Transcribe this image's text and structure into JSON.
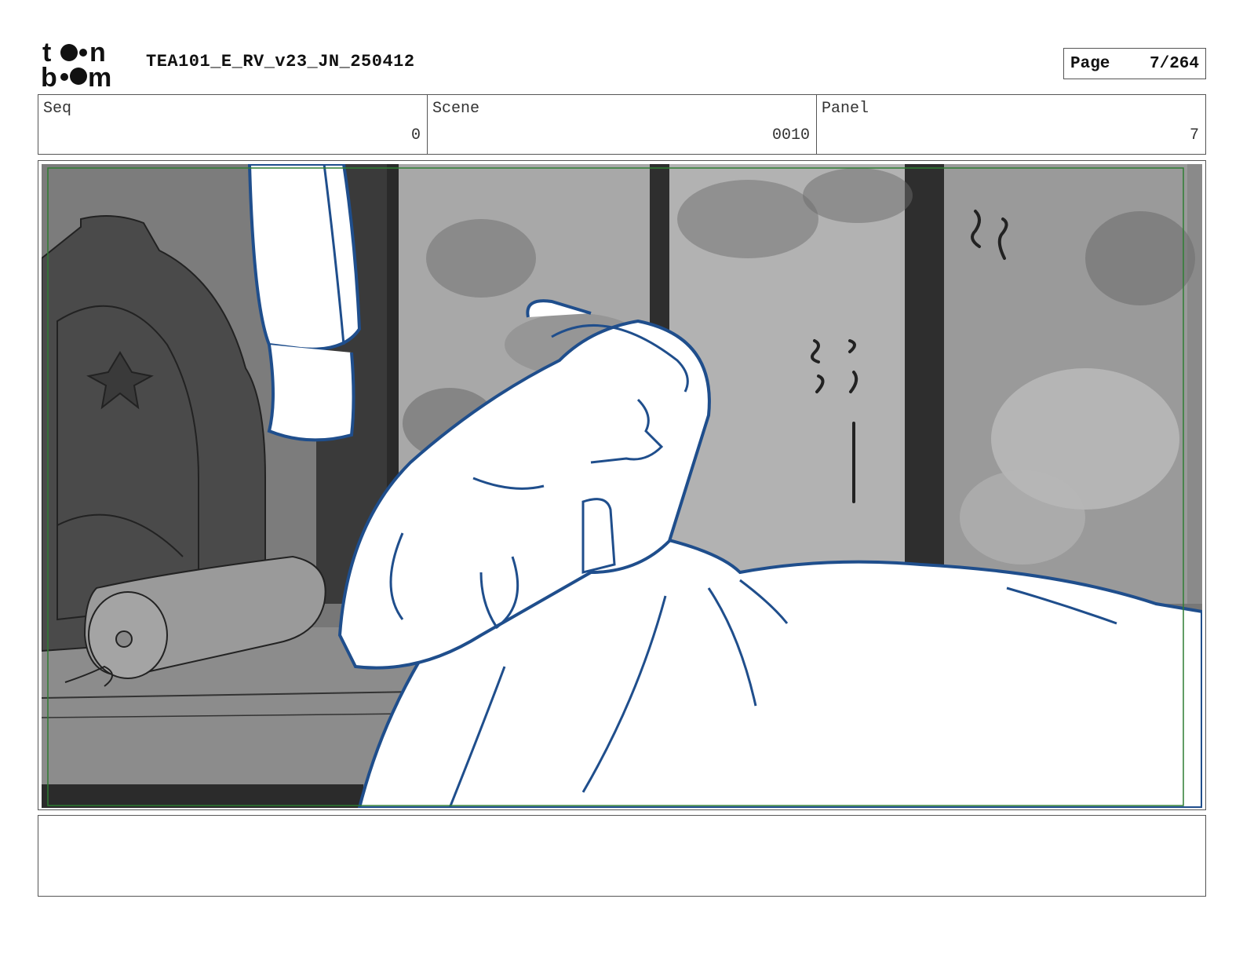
{
  "header": {
    "logo_text_top": "toon",
    "logo_text_bottom": "boom",
    "title": "TEA101_E_RV_v23_JN_250412",
    "page_label": "Page",
    "page_value": "7/264"
  },
  "info": {
    "seq_label": "Seq",
    "seq_value": "0",
    "scene_label": "Scene",
    "scene_value": "0010",
    "panel_label": "Panel",
    "panel_value": "7"
  },
  "notes": {
    "text": ""
  },
  "colors": {
    "sketch_line": "#1f4e8c",
    "safe_frame": "#2e7d32",
    "background_gray": "#7a7a7a"
  },
  "icons": {
    "logo": "toon-boom-logo"
  }
}
